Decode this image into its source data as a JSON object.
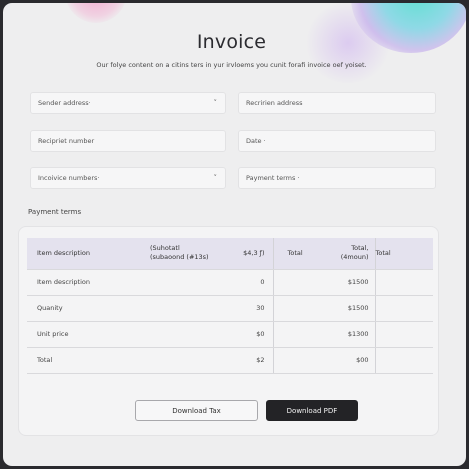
{
  "title": "Invoice",
  "subtitle": "Our folye content on a citins ters in yur irvloems you cunit forafi invoice oef yoiset.",
  "fields": {
    "sender_address": "Sender address·",
    "recipient_address": "Recririen address",
    "recipient_number": "Recipriet number",
    "date": "Date ·",
    "invoice_number": "Incoivice numbers·",
    "payment_terms": "Payment terms ·",
    "chevron": "˅"
  },
  "section_label": "Payment terms",
  "table": {
    "headers": {
      "description": "Item description",
      "subtotal": "(Suhotatl\n(subaoond (#13s)",
      "subtotal_value": "$4,3 ƒ)",
      "total": "Total",
      "total_amount": "Total,\n(4moun)",
      "total2": "Total"
    },
    "rows": [
      {
        "label": "Item description",
        "subtotal": "0",
        "total_amount": "$1500"
      },
      {
        "label": "Quanity",
        "subtotal": "30",
        "total_amount": "$1500"
      },
      {
        "label": "Unit price",
        "subtotal": "$0",
        "total_amount": "$1300"
      },
      {
        "label": "Total",
        "subtotal": "$2",
        "total_amount": "$00"
      }
    ]
  },
  "buttons": {
    "download_tax": "Download Tax",
    "download_pdf": "Download PDF"
  }
}
